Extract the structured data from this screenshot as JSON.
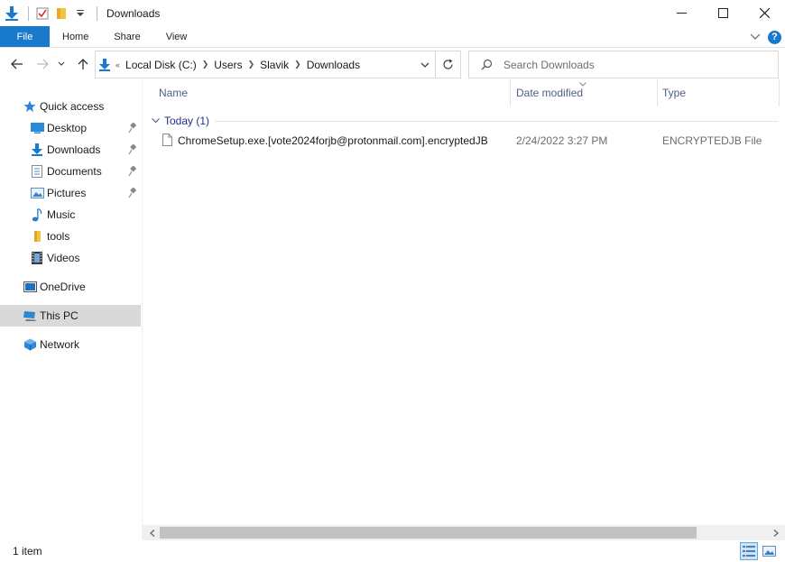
{
  "window": {
    "title": "Downloads",
    "buttons": {
      "minimize": "—",
      "maximize": "☐",
      "close": "✕"
    }
  },
  "ribbon": {
    "tabs": [
      {
        "label": "File"
      },
      {
        "label": "Home"
      },
      {
        "label": "Share"
      },
      {
        "label": "View"
      }
    ],
    "help_label": "?"
  },
  "address": {
    "crumbs": [
      "Local Disk (C:)",
      "Users",
      "Slavik",
      "Downloads"
    ]
  },
  "search": {
    "placeholder": "Search Downloads"
  },
  "sidebar": {
    "items": [
      {
        "label": "Quick access",
        "icon": "star-icon",
        "pinned": false
      },
      {
        "label": "Desktop",
        "icon": "desktop-icon",
        "pinned": true
      },
      {
        "label": "Downloads",
        "icon": "download-icon",
        "pinned": true
      },
      {
        "label": "Documents",
        "icon": "documents-icon",
        "pinned": true
      },
      {
        "label": "Pictures",
        "icon": "pictures-icon",
        "pinned": true
      },
      {
        "label": "Music",
        "icon": "music-icon",
        "pinned": false
      },
      {
        "label": "tools",
        "icon": "folder-icon",
        "pinned": false
      },
      {
        "label": "Videos",
        "icon": "videos-icon",
        "pinned": false
      },
      {
        "label": "OneDrive",
        "icon": "onedrive-icon",
        "pinned": false
      },
      {
        "label": "This PC",
        "icon": "computer-icon",
        "pinned": false,
        "selected": true
      },
      {
        "label": "Network",
        "icon": "network-icon",
        "pinned": false
      }
    ]
  },
  "columns": {
    "name": "Name",
    "date": "Date modified",
    "type": "Type"
  },
  "groups": [
    {
      "label": "Today (1)",
      "files": [
        {
          "name": "ChromeSetup.exe.[vote2024forjb@protonmail.com].encryptedJB",
          "date": "2/24/2022 3:27 PM",
          "type": "ENCRYPTEDJB File"
        }
      ]
    }
  ],
  "status": {
    "count": "1 item"
  },
  "colors": {
    "accent": "#1979ca",
    "selection": "#d9d9d9",
    "group_text": "#1e3287",
    "header_text": "#4d6082"
  }
}
